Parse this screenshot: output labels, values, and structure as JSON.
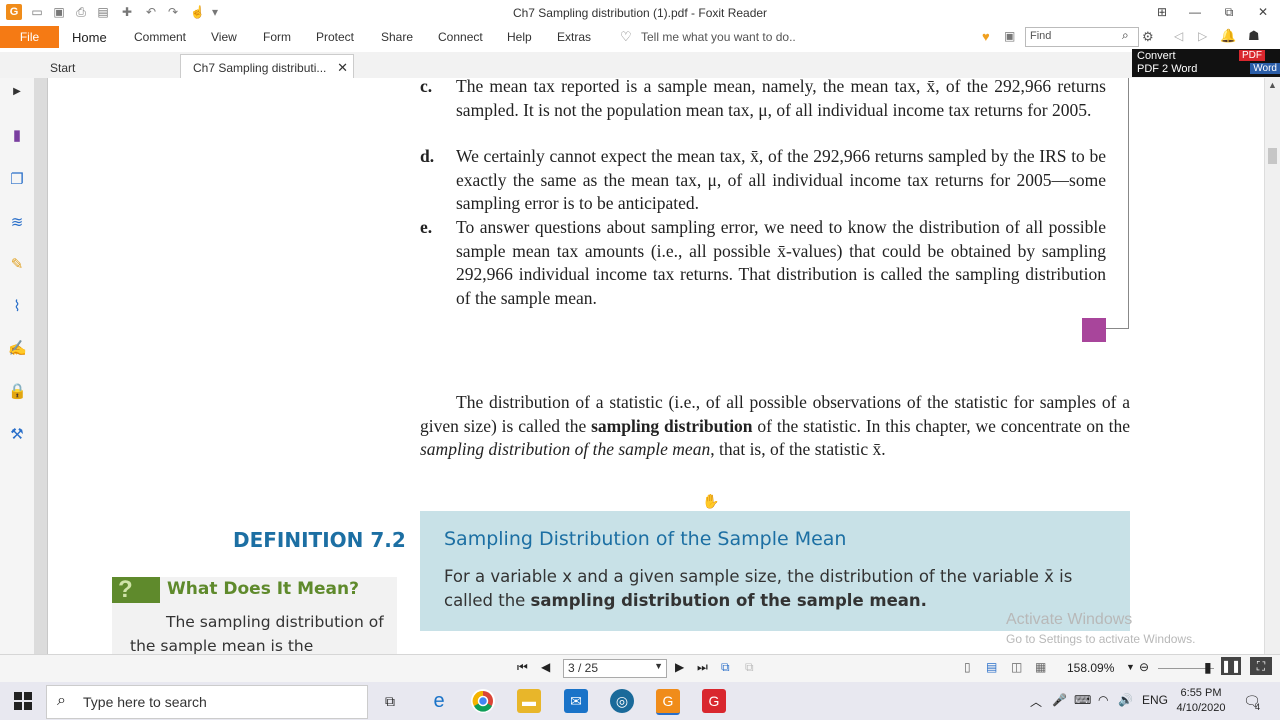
{
  "window": {
    "title": "Ch7 Sampling distribution (1).pdf - Foxit Reader",
    "controls": [
      "⊞",
      "—",
      "⧉",
      "✕"
    ]
  },
  "ribbon": {
    "file": "File",
    "tabs": [
      "Home",
      "Comment",
      "View",
      "Form",
      "Protect",
      "Share",
      "Connect",
      "Help",
      "Extras"
    ],
    "tell_me": "Tell me what you want to do..",
    "find_placeholder": "Find"
  },
  "doc_tabs": {
    "start": "Start",
    "active": "Ch7 Sampling distributi...",
    "close": "✕"
  },
  "ad": {
    "line1": "Convert",
    "line2": "PDF 2 Word",
    "pdf": "PDF",
    "word": "Word"
  },
  "document": {
    "items": [
      {
        "letter": "c.",
        "text": "The mean tax reported is a sample mean, namely, the mean tax, x̄, of the 292,966 returns sampled. It is not the population mean tax, μ, of all individual income tax returns for 2005."
      },
      {
        "letter": "d.",
        "text": "We certainly cannot expect the mean tax, x̄, of the 292,966 returns sampled by the IRS to be exactly the same as the mean tax, μ, of all individual income tax returns for 2005—some sampling error is to be anticipated."
      },
      {
        "letter": "e.",
        "text": "To answer questions about sampling error, we need to know the distribution of all possible sample mean tax amounts (i.e., all possible x̄-values) that could be obtained by sampling 292,966 individual income tax returns. That distribution is called the sampling distribution of the sample mean."
      }
    ],
    "paragraph": {
      "part1": "The distribution of a statistic (i.e., of all possible observations of the statistic for samples of a given size) is called the ",
      "bold1": "sampling distribution",
      "part2": " of the statistic. In this chapter, we concentrate on the ",
      "italic1": "sampling distribution of the sample mean",
      "part3": ", that is, of the statistic x̄."
    },
    "definition": {
      "label": "DEFINITION 7.2",
      "title": "Sampling Distribution of the Sample Mean",
      "text_part1": "For a variable x and a given sample size, the distribution of the variable x̄ is called the ",
      "text_bold": "sampling distribution of the sample mean."
    },
    "what_does_it_mean": {
      "icon": "?",
      "title": "What Does It Mean?",
      "text": "The sampling distribution of the sample mean is the"
    }
  },
  "watermark": {
    "line1": "Activate Windows",
    "line2": "Go to Settings to activate Windows."
  },
  "status_bar": {
    "page": "3 / 25",
    "zoom": "158.09%"
  },
  "taskbar": {
    "search_placeholder": "Type here to search",
    "language": "ENG",
    "time": "6:55 PM",
    "date": "4/10/2020",
    "notification_count": "4"
  },
  "colors": {
    "file_tab": "#f57a14",
    "definition_blue": "#1c6fa3",
    "definition_box": "#c8e1e7",
    "green": "#5f8a2c",
    "comment_square": "#a8459b"
  }
}
